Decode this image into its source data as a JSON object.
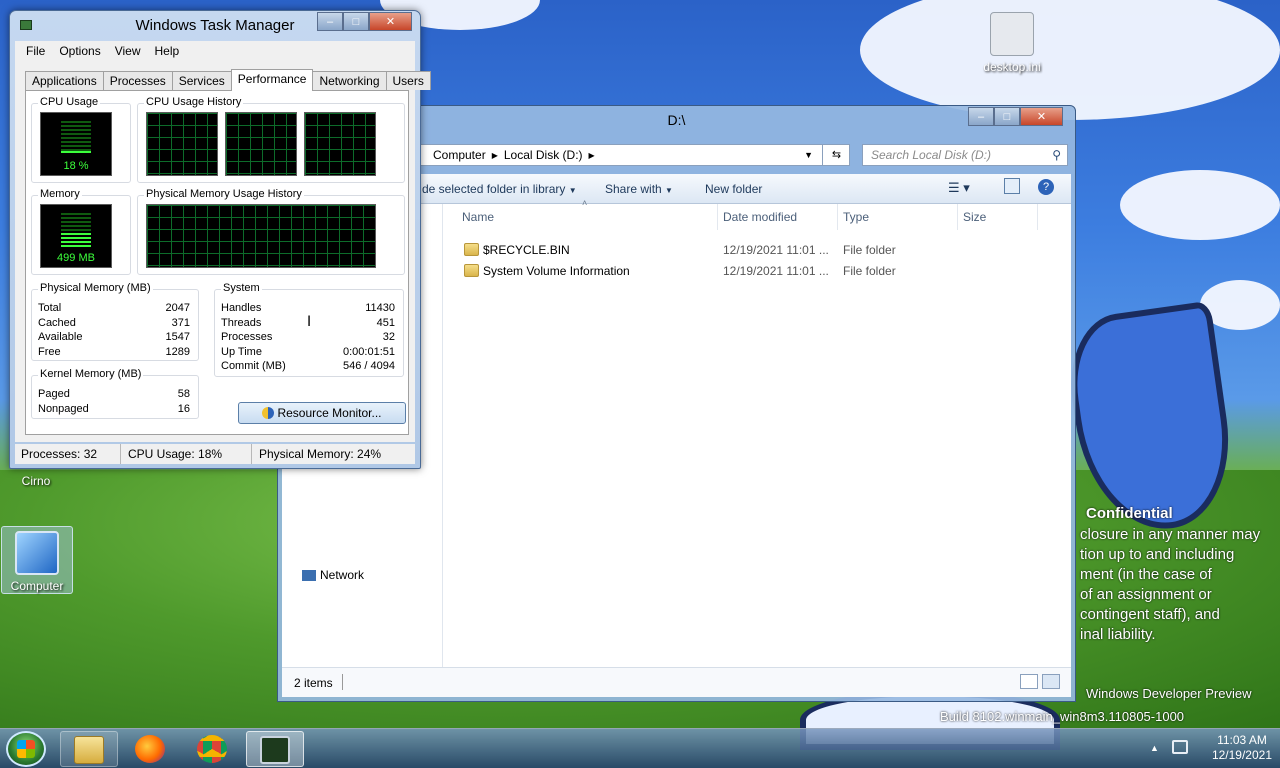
{
  "desktop": {
    "icons": [
      {
        "label": "desktop.ini"
      },
      {
        "label": "Cirno"
      },
      {
        "label": "Computer"
      }
    ],
    "watermark_lines": [
      "Confidential",
      "closure in any manner may",
      "tion up to and including",
      "ment (in the case of",
      "of an assignment or",
      "contingent staff), and",
      "inal liability."
    ],
    "build_lines": [
      "Windows Developer Preview",
      "Build 8102.winmain_win8m3.110805-1000"
    ]
  },
  "taskmgr": {
    "title": "Windows Task Manager",
    "menu": [
      "File",
      "Options",
      "View",
      "Help"
    ],
    "tabs": [
      "Applications",
      "Processes",
      "Services",
      "Performance",
      "Networking",
      "Users"
    ],
    "active_tab": "Performance",
    "cpu_usage_label": "CPU Usage",
    "cpu_usage_value": "18 %",
    "cpu_usage_fraction": 0.18,
    "cpu_history_label": "CPU Usage History",
    "memory_label": "Memory",
    "memory_value": "499 MB",
    "phys_history_label": "Physical Memory Usage History",
    "physical_memory": {
      "label": "Physical Memory (MB)",
      "rows": [
        {
          "k": "Total",
          "v": "2047"
        },
        {
          "k": "Cached",
          "v": "371"
        },
        {
          "k": "Available",
          "v": "1547"
        },
        {
          "k": "Free",
          "v": "1289"
        }
      ]
    },
    "system": {
      "label": "System",
      "rows": [
        {
          "k": "Handles",
          "v": "11430"
        },
        {
          "k": "Threads",
          "v": "451"
        },
        {
          "k": "Processes",
          "v": "32"
        },
        {
          "k": "Up Time",
          "v": "0:00:01:51"
        },
        {
          "k": "Commit (MB)",
          "v": "546 / 4094"
        }
      ]
    },
    "kernel_memory": {
      "label": "Kernel Memory (MB)",
      "rows": [
        {
          "k": "Paged",
          "v": "58"
        },
        {
          "k": "Nonpaged",
          "v": "16"
        }
      ]
    },
    "resource_monitor_label": "Resource Monitor...",
    "status": {
      "processes": "Processes: 32",
      "cpu": "CPU Usage: 18%",
      "memory": "Physical Memory: 24%"
    }
  },
  "explorer": {
    "title": "D:\\",
    "breadcrumb": [
      "Computer",
      "Local Disk (D:)"
    ],
    "search_placeholder": "Search Local Disk (D:)",
    "commands": [
      "de selected folder in library",
      "Share with",
      "New folder"
    ],
    "columns": [
      "Name",
      "Date modified",
      "Type",
      "Size"
    ],
    "files": [
      {
        "name": "$RECYCLE.BIN",
        "date": "12/19/2021 11:01 ...",
        "type": "File folder",
        "size": ""
      },
      {
        "name": "System Volume Information",
        "date": "12/19/2021 11:01 ...",
        "type": "File folder",
        "size": ""
      }
    ],
    "nav_item": "Network",
    "status": "2 items"
  },
  "taskbar": {
    "time": "11:03 AM",
    "date": "12/19/2021"
  }
}
